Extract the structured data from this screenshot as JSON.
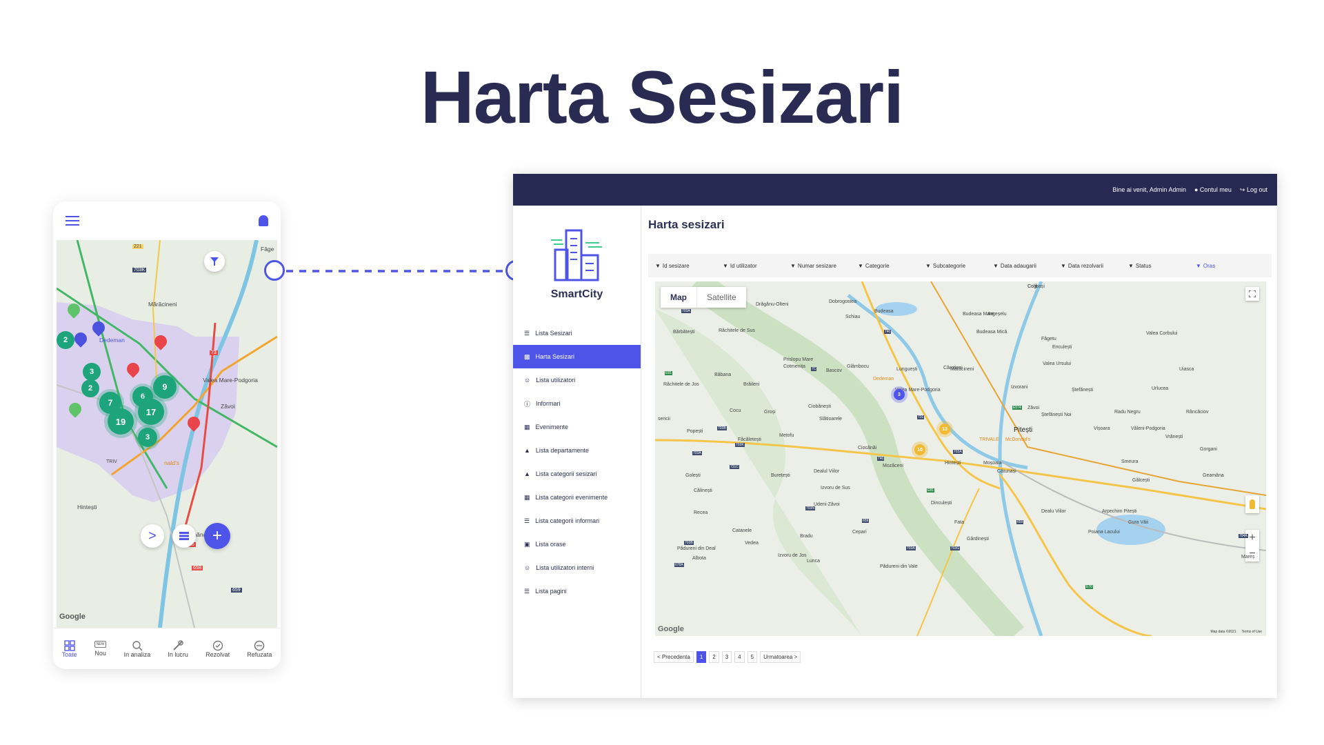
{
  "page": {
    "title": "Harta Sesizari"
  },
  "mobile": {
    "map_labels": [
      "Fâge",
      "Mărăcineni",
      "Dedeman",
      "Valea Mare-Podgoria",
      "Zăvoi",
      "Hintești",
      "Geamăna",
      "TRIV",
      "nald's"
    ],
    "road_labels": [
      "221",
      "703K",
      "73",
      "65",
      "65B",
      "659"
    ],
    "clusters": [
      "2",
      "3",
      "2",
      "7",
      "6",
      "9",
      "17",
      "19",
      "3"
    ],
    "google": "Google",
    "tabs": [
      {
        "label": "Toate",
        "icon": "grid-icon"
      },
      {
        "label": "Nou",
        "icon": "new-badge-icon"
      },
      {
        "label": "In analiza",
        "icon": "analysis-icon"
      },
      {
        "label": "In lucru",
        "icon": "work-icon"
      },
      {
        "label": "Rezolvat",
        "icon": "check-icon"
      },
      {
        "label": "Refuzata",
        "icon": "refused-icon"
      }
    ],
    "fab_next": ">",
    "fab_add": "+",
    "new_badge": "NEW"
  },
  "desktop": {
    "header": {
      "welcome": "Bine ai venit, Admin Admin",
      "account": "Contul meu",
      "logout": "Log out"
    },
    "logo": "SmartCity",
    "menu": [
      {
        "label": "Lista Sesizari",
        "icon": "list-icon"
      },
      {
        "label": "Harta Sesizari",
        "icon": "map-icon"
      },
      {
        "label": "Lista utilizatori",
        "icon": "users-icon"
      },
      {
        "label": "Informari",
        "icon": "info-icon"
      },
      {
        "label": "Evenimente",
        "icon": "calendar-icon"
      },
      {
        "label": "Lista departamente",
        "icon": "bell-icon"
      },
      {
        "label": "Lista categorii sesizari",
        "icon": "bell-icon"
      },
      {
        "label": "Lista categorii evenimente",
        "icon": "calendar-icon"
      },
      {
        "label": "Lista categorii informari",
        "icon": "list-filter-icon"
      },
      {
        "label": "Lista orase",
        "icon": "city-icon"
      },
      {
        "label": "Lista utilizatori interni",
        "icon": "user-list-icon"
      },
      {
        "label": "Lista pagini",
        "icon": "list-icon"
      }
    ],
    "page_title": "Harta sesizari",
    "filters": [
      "Id sesizare",
      "Id utilizator",
      "Numar sesizare",
      "Categorie",
      "Subcategorie",
      "Data adaugarii",
      "Data rezolvarii",
      "Status",
      "Oras"
    ],
    "map_toggle": {
      "map": "Map",
      "satellite": "Satellite"
    },
    "map_labels": [
      "Colibași",
      "Dobrogostea",
      "Budeasa",
      "Drăgănu-Olteni",
      "Schiau",
      "Budeasa Mare",
      "Argeșelu",
      "Bărbătești",
      "Răchitele de Sus",
      "Budeasa Mică",
      "Făgetu",
      "Valea Corbului",
      "Prislopu Mare",
      "Enculești",
      "Cotmenița",
      "Glâmbocu",
      "Mărăcineni",
      "Valea Ursului",
      "Bascov",
      "Lunguești",
      "Răchitele de Jos",
      "Băbana",
      "Brăileni",
      "Dedeman",
      "Cârstieni",
      "Uiasca",
      "Valea Mare-Podgoria",
      "Izvorani",
      "Ștefănești",
      "Urlucea",
      "Cocu",
      "Groși",
      "Ciobănești",
      "Zăvoi",
      "Ștefănești Noi",
      "Radu Negru",
      "Râncăciov",
      "sericii",
      "Slătioarele",
      "Pitești",
      "Popești",
      "Metofu",
      "TRIVALE",
      "McDonald's",
      "Vișoara",
      "Văleni-Podgoria",
      "Vrănești",
      "Făcăletești",
      "Ciocănăi",
      "Hintești",
      "Gorgani",
      "Mozăceni",
      "Moșoaia",
      "Golești",
      "Burețești",
      "Dealul Viilor",
      "Cătunași",
      "Smeura",
      "Geamăna",
      "Călinești",
      "Izvoru de Sus",
      "Gălcești",
      "Udeni-Zăvoi",
      "Dinculești",
      "Dealu Viilor",
      "Arpechim Pitești",
      "Recea",
      "Fata",
      "Gura Văii",
      "Catanele",
      "Cepari",
      "Poiana Lacului",
      "Bradu",
      "Pădureni din Deal",
      "Vedea",
      "Gârdinești",
      "Albota",
      "Izvoru de Jos",
      "Pădureni din Vale",
      "Mareș",
      "Lunca",
      "Cogi"
    ],
    "map_roads": [
      "703A",
      "740",
      "E81",
      "7C",
      "740",
      "703B",
      "703K",
      "703A",
      "731C",
      "731",
      "703A",
      "E574",
      "E81",
      "659",
      "703B",
      "703N",
      "703A",
      "703G",
      "659",
      "678A",
      "E70",
      "704A"
    ],
    "map_clusters": [
      "3",
      "13",
      "10"
    ],
    "map_footer": {
      "google": "Google",
      "data": "Map data ©2021",
      "terms": "Terms of Use"
    },
    "pagination": {
      "prev": "< Precedenta",
      "pages": [
        "1",
        "2",
        "3",
        "4",
        "5"
      ],
      "next": "Urmatoarea >"
    }
  }
}
